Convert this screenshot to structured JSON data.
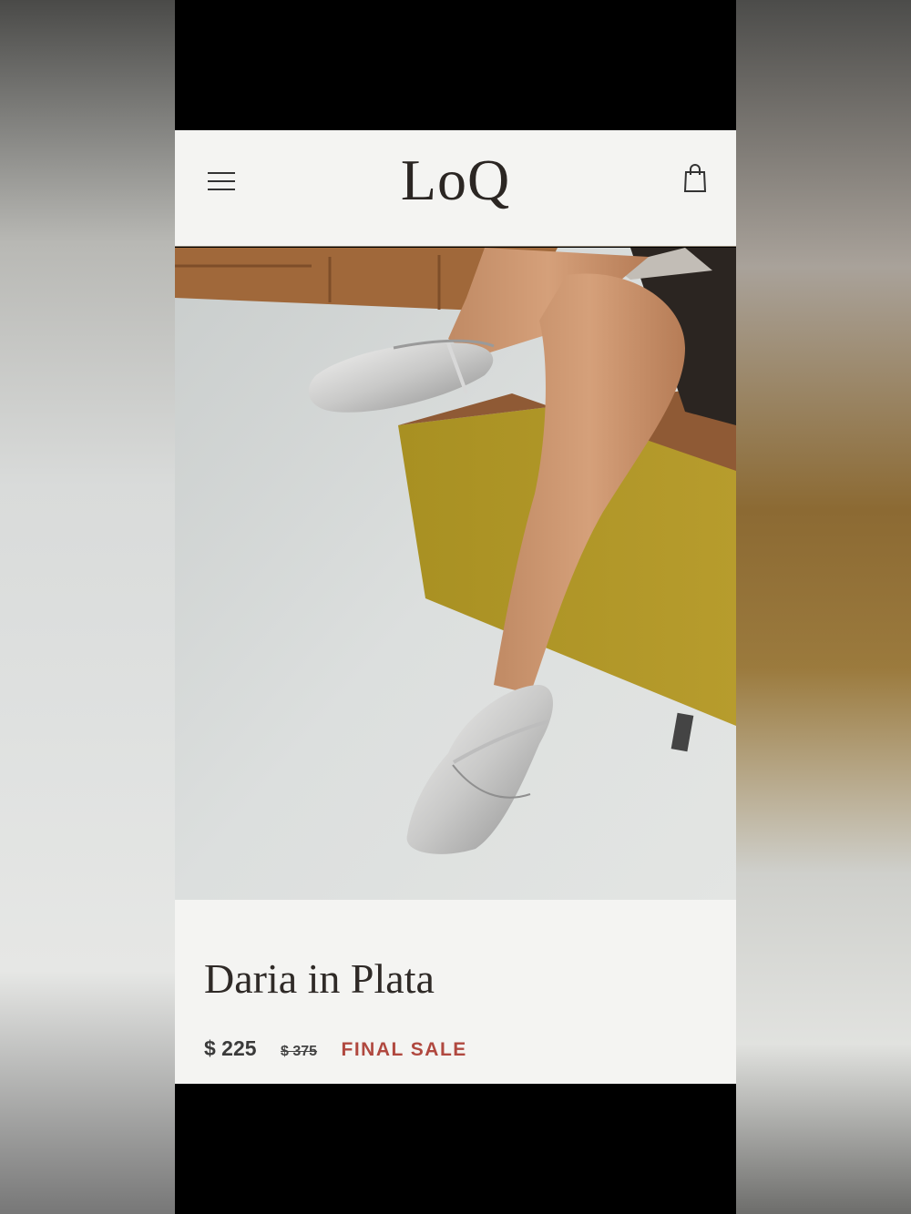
{
  "brand": {
    "logo_text": "LoQ"
  },
  "header": {
    "menu_icon": "hamburger-menu-icon",
    "cart_icon": "shopping-bag-icon"
  },
  "gallery": {
    "slide_count": 5,
    "active_index": 0
  },
  "product": {
    "title": "Daria in Plata",
    "price_current": "$ 225",
    "price_original": "$ 375",
    "sale_label": "FINAL SALE"
  },
  "colors": {
    "sale": "#b0483f",
    "background": "#f4f4f2",
    "text": "#2f2a27"
  }
}
